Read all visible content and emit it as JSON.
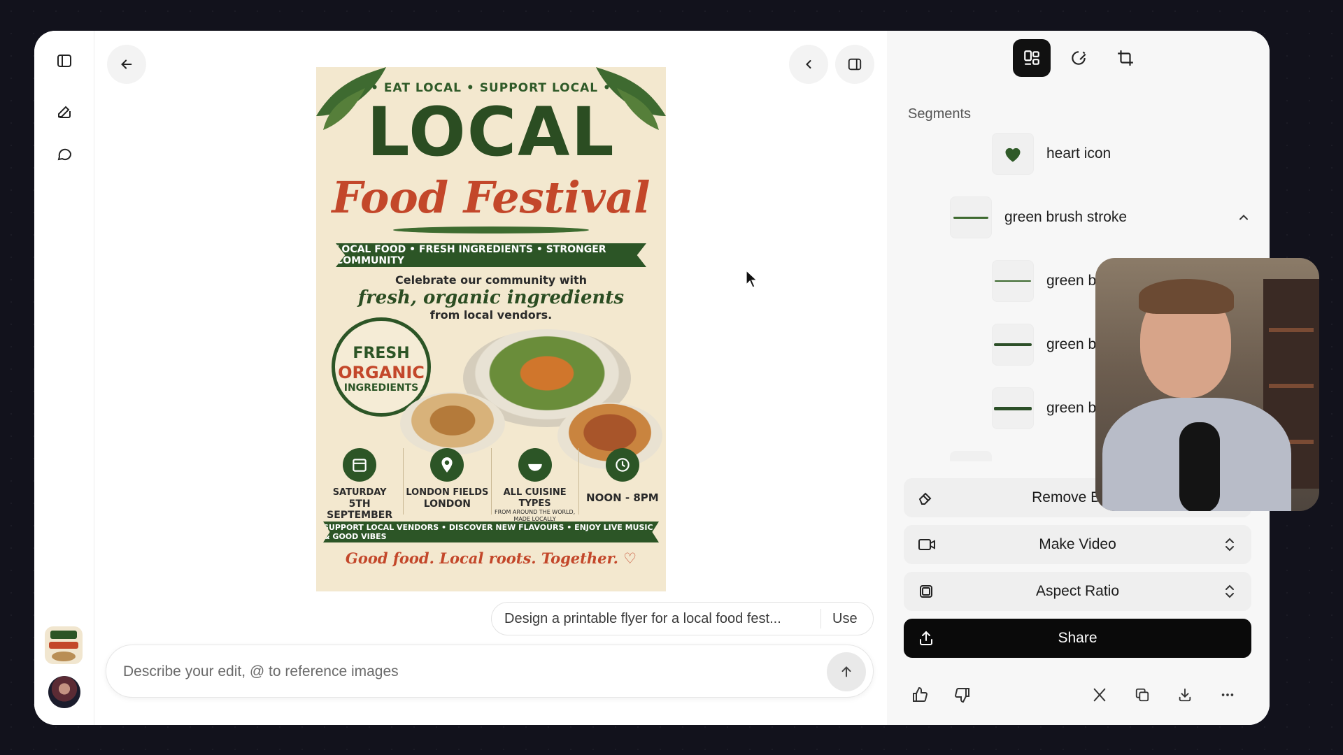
{
  "main": {
    "suggestion": {
      "text": "Design a printable flyer for a local food fest...",
      "use_label": "Use"
    },
    "composer": {
      "placeholder": "Describe your edit, @ to reference images"
    }
  },
  "flyer": {
    "top": "• EAT LOCAL • SUPPORT LOCAL •",
    "title": "LOCAL",
    "subtitle": "Food Festival",
    "ribbon": "LOCAL FOOD • FRESH INGREDIENTS • STRONGER COMMUNITY",
    "celebrate": "Celebrate our community with",
    "fresh": "fresh, organic ingredients",
    "from": "from local vendors.",
    "badge": {
      "line1": "FRESH",
      "line2": "ORGANIC",
      "line3": "INGREDIENTS"
    },
    "info": [
      {
        "line1": "SATURDAY",
        "line2": "5TH SEPTEMBER",
        "line3": ""
      },
      {
        "line1": "LONDON FIELDS",
        "line2": "LONDON",
        "line3": ""
      },
      {
        "line1": "ALL CUISINE TYPES",
        "line2": "",
        "line3": "FROM AROUND THE WORLD, MADE LOCALLY"
      },
      {
        "line1": "NOON - 8PM",
        "line2": "",
        "line3": ""
      }
    ],
    "bottom_ribbon": "SUPPORT LOCAL VENDORS • DISCOVER NEW FLAVOURS • ENJOY LIVE MUSIC & GOOD VIBES",
    "tagline": "Good food. Local roots. Together. ♡"
  },
  "panel": {
    "segments_title": "Segments",
    "segments": [
      {
        "label": "heart icon",
        "indent": true
      },
      {
        "label": "green brush stroke",
        "indent": false,
        "expanded": true
      },
      {
        "label": "green brush",
        "indent": true
      },
      {
        "label": "green brush",
        "indent": true
      },
      {
        "label": "green brush",
        "indent": true
      }
    ],
    "actions": {
      "remove_background": "Remove Back",
      "make_video": "Make Video",
      "aspect_ratio": "Aspect Ratio",
      "share": "Share"
    }
  },
  "colors": {
    "accent_green": "#2c5526",
    "flyer_red": "#c3472a",
    "share_bg": "#0a0a0a"
  }
}
